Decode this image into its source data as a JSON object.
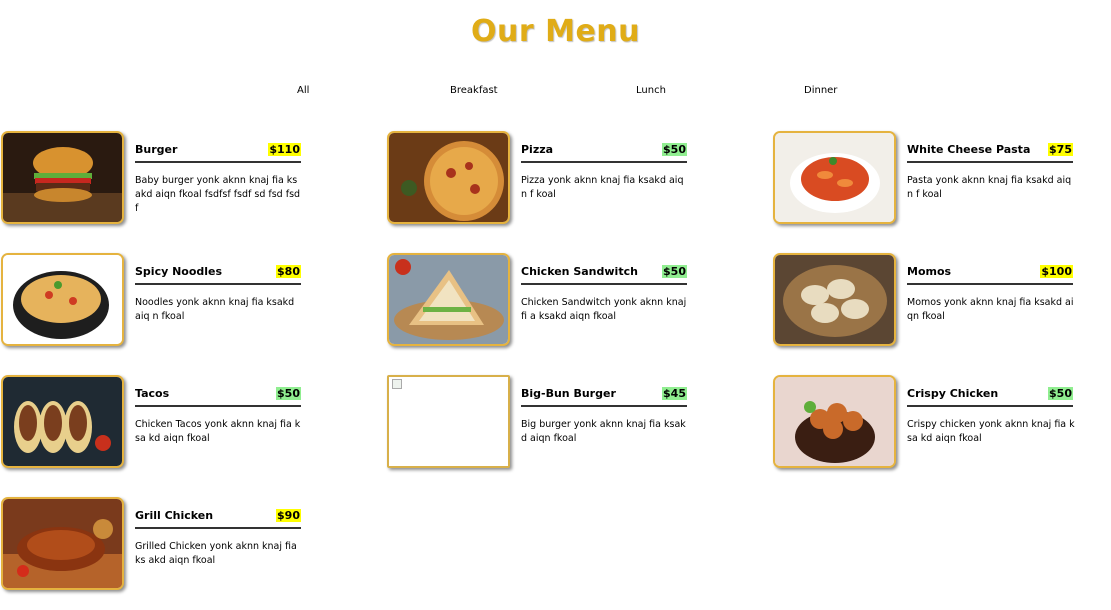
{
  "header": {
    "title": "Our Menu"
  },
  "tabs": [
    "All",
    "Breakfast",
    "Lunch",
    "Dinner"
  ],
  "colors": {
    "title": "#e0ac17",
    "border": "#e5b33f",
    "price_yellow": "#ffff00",
    "price_green": "#90ee90"
  },
  "items": [
    {
      "name": "Burger",
      "price": "$110",
      "price_color": "yellow",
      "desc": "Baby burger yonk aknn knaj fia ksakd aiqn fkoal fsdfsf fsdf sd fsd fsd f",
      "icon": "burger-image"
    },
    {
      "name": "Pizza",
      "price": "$50",
      "price_color": "green",
      "desc": "Pizza yonk aknn knaj fia ksakd aiqn f koal",
      "icon": "pizza-image"
    },
    {
      "name": "White Cheese Pasta",
      "price": "$75",
      "price_color": "yellow",
      "desc": "Pasta yonk aknn knaj fia ksakd aiqn f koal",
      "icon": "pasta-image"
    },
    {
      "name": "Spicy Noodles",
      "price": "$80",
      "price_color": "yellow",
      "desc": "Noodles yonk aknn knaj fia ksakd aiq n fkoal",
      "icon": "noodles-image"
    },
    {
      "name": "Chicken Sandwitch",
      "price": "$50",
      "price_color": "green",
      "desc": "Chicken Sandwitch yonk aknn knaj fi a ksakd aiqn fkoal",
      "icon": "sandwich-image"
    },
    {
      "name": "Momos",
      "price": "$100",
      "price_color": "yellow",
      "desc": "Momos yonk aknn knaj fia ksakd aiqn fkoal",
      "icon": "momos-image"
    },
    {
      "name": "Tacos",
      "price": "$50",
      "price_color": "green",
      "desc": "Chicken Tacos yonk aknn knaj fia ksa kd aiqn fkoal",
      "icon": "tacos-image"
    },
    {
      "name": "Big-Bun Burger",
      "price": "$45",
      "price_color": "green",
      "desc": "Big burger yonk aknn knaj fia ksakd aiqn fkoal",
      "icon": "broken-image"
    },
    {
      "name": "Crispy Chicken",
      "price": "$50",
      "price_color": "green",
      "desc": "Crispy chicken yonk aknn knaj fia ksa kd aiqn fkoal",
      "icon": "crispy-chicken-image"
    },
    {
      "name": "Grill Chicken",
      "price": "$90",
      "price_color": "yellow",
      "desc": "Grilled Chicken yonk aknn knaj fia ks akd aiqn fkoal",
      "icon": "grill-chicken-image"
    }
  ]
}
